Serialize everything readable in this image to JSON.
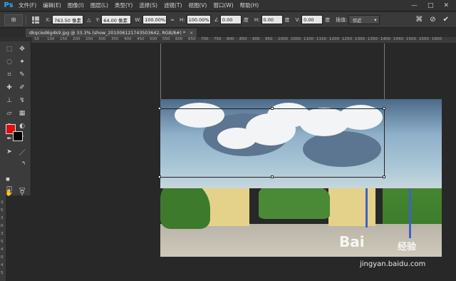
{
  "app": {
    "logo": "Ps"
  },
  "menu": [
    "文件(F)",
    "编辑(E)",
    "图像(I)",
    "图层(L)",
    "类型(Y)",
    "选择(S)",
    "滤镜(T)",
    "视图(V)",
    "窗口(W)",
    "帮助(H)"
  ],
  "window_controls": [
    "—",
    "□",
    "✕"
  ],
  "options": {
    "x_label": "X:",
    "x_value": "763.50 像素",
    "y_label": "Y:",
    "y_value": "64.00 像素",
    "w_label": "W:",
    "w_value": "100.00%",
    "h_label": "H:",
    "h_value": "100.00%",
    "angle_value": "0.00",
    "angle_unit": "度",
    "hskew_label": "H:",
    "hskew_value": "0.00",
    "hskew_unit": "度",
    "vskew_label": "V:",
    "vskew_value": "0.00",
    "vskew_unit": "度",
    "interp_label": "插值:",
    "interp_value": "邻近"
  },
  "document_tab": {
    "title": "dkqcied6g4k9.jpg @ 33.3% (show_201006121743503642, RGB/8#) *",
    "close": "×"
  },
  "ruler_top": [
    "50",
    "100",
    "150",
    "200",
    "250",
    "300",
    "350",
    "400",
    "450",
    "500",
    "550",
    "600",
    "650",
    "700",
    "750",
    "800",
    "850",
    "900",
    "950",
    "1000",
    "1050",
    "1100",
    "1150",
    "1200",
    "1250",
    "1300",
    "1350",
    "1400",
    "1450",
    "1500",
    "1550",
    "1600"
  ],
  "ruler_left": [
    "2",
    "5",
    "3",
    "0",
    "3",
    "5",
    "4",
    "0",
    "4",
    "5"
  ],
  "colors": {
    "foreground": "#e00d0d",
    "background": "#000000",
    "accent": "#31a8ff"
  },
  "watermark": {
    "brand": "Bai",
    "brand2": "经验",
    "url": "jingyan.baidu.com"
  }
}
